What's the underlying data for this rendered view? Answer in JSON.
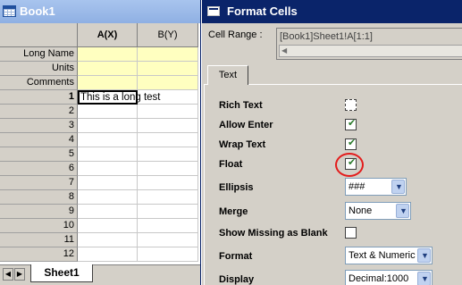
{
  "book": {
    "title": "Book1",
    "columns": [
      "A(X)",
      "B(Y)"
    ],
    "label_rows": [
      "Long Name",
      "Units",
      "Comments"
    ],
    "rows": [
      "1",
      "2",
      "3",
      "4",
      "5",
      "6",
      "7",
      "8",
      "9",
      "10",
      "11",
      "12"
    ],
    "cell_A1": "This is a long test",
    "sheet_tab": "Sheet1"
  },
  "dialog": {
    "title": "Format Cells",
    "cell_range_label": "Cell Range :",
    "cell_range_value": "[Book1]Sheet1!A[1:1]",
    "tab": "Text",
    "properties": [
      {
        "label": "Rich Text",
        "checked": false
      },
      {
        "label": "Allow Enter",
        "checked": true
      },
      {
        "label": "Wrap Text",
        "checked": true
      },
      {
        "label": "Float",
        "checked": true
      },
      {
        "label": "Ellipsis",
        "value": "###"
      },
      {
        "label": "Merge",
        "value": "None"
      },
      {
        "label": "Show Missing as Blank",
        "checked": false
      },
      {
        "label": "Format",
        "value": "Text & Numeric"
      },
      {
        "label": "Display",
        "value": "Decimal:1000"
      }
    ]
  },
  "colors": {
    "dialog_titlebar": "#0a246a",
    "book_titlebar": "#a8c4ee",
    "label_rows_fill": "#ffffc0",
    "float_highlight": "#e31c1c"
  }
}
